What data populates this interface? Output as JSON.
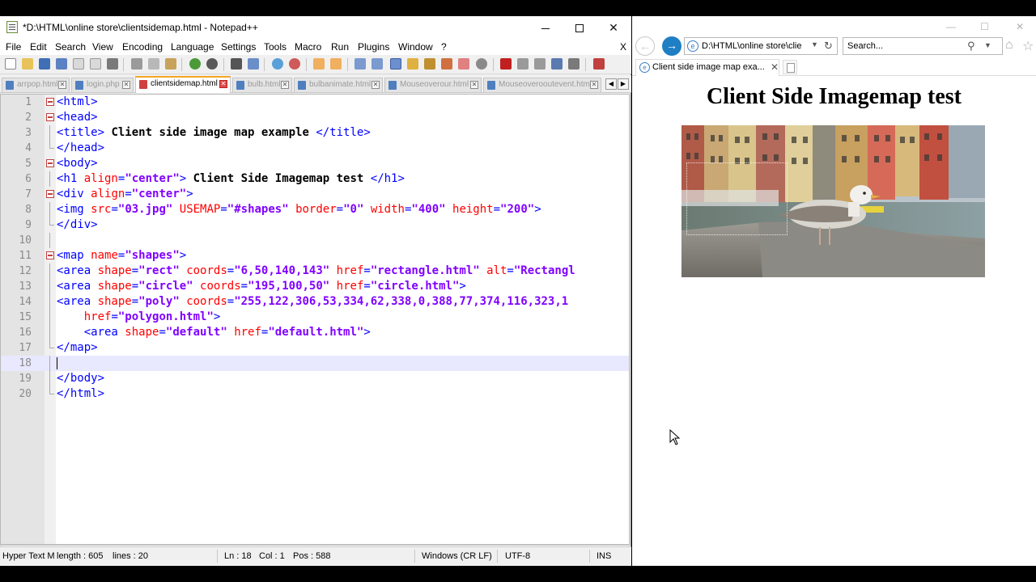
{
  "notepad": {
    "title": "*D:\\HTML\\online store\\clientsidemap.html - Notepad++",
    "menu": [
      "File",
      "Edit",
      "Search",
      "View",
      "Encoding",
      "Language",
      "Settings",
      "Tools",
      "Macro",
      "Run",
      "Plugins",
      "Window",
      "?"
    ],
    "menu_close": "X",
    "tabs": [
      {
        "label": "arrpop.html",
        "active": false
      },
      {
        "label": "login.php",
        "active": false
      },
      {
        "label": "clientsidemap.html",
        "active": true
      },
      {
        "label": "bulb.html",
        "active": false
      },
      {
        "label": "bulbanimate.html",
        "active": false
      },
      {
        "label": "Mouseoverour.html",
        "active": false
      },
      {
        "label": "Mouseoverooutevent.html",
        "active": false
      }
    ],
    "code_lines": [
      {
        "n": "1",
        "html": "<span class=\"tag\">&lt;html&gt;</span>"
      },
      {
        "n": "2",
        "html": "<span class=\"tag\">&lt;head&gt;</span>"
      },
      {
        "n": "3",
        "html": "<span class=\"tag\">&lt;title&gt;</span><span class=\"txt\"> Client side image map example </span><span class=\"tag\">&lt;/title&gt;</span>"
      },
      {
        "n": "4",
        "html": "<span class=\"tag\">&lt;/head&gt;</span>"
      },
      {
        "n": "5",
        "html": "<span class=\"tag\">&lt;body&gt;</span>"
      },
      {
        "n": "6",
        "html": "<span class=\"tag\">&lt;h1 </span><span class=\"attr\">align</span><span class=\"tag\">=</span><span class=\"val\">\"center\"</span><span class=\"tag\">&gt;</span><span class=\"txt\"> Client Side Imagemap test </span><span class=\"tag\">&lt;/h1&gt;</span>"
      },
      {
        "n": "7",
        "html": "<span class=\"tag\">&lt;div </span><span class=\"attr\">align</span><span class=\"tag\">=</span><span class=\"val\">\"center\"</span><span class=\"tag\">&gt;</span>"
      },
      {
        "n": "8",
        "html": "<span class=\"tag\">&lt;img </span><span class=\"attr\">src</span><span class=\"tag\">=</span><span class=\"val\">\"03.jpg\"</span><span class=\"tag\"> </span><span class=\"attr\">USEMAP</span><span class=\"tag\">=</span><span class=\"val\">\"#shapes\"</span><span class=\"tag\"> </span><span class=\"attr\">border</span><span class=\"tag\">=</span><span class=\"val\">\"0\"</span><span class=\"tag\"> </span><span class=\"attr\">width</span><span class=\"tag\">=</span><span class=\"val\">\"400\"</span><span class=\"tag\"> </span><span class=\"attr\">height</span><span class=\"tag\">=</span><span class=\"val\">\"200\"</span><span class=\"tag\">&gt;</span>"
      },
      {
        "n": "9",
        "html": "<span class=\"tag\">&lt;/div&gt;</span>"
      },
      {
        "n": "10",
        "html": ""
      },
      {
        "n": "11",
        "html": "<span class=\"tag\">&lt;map </span><span class=\"attr\">name</span><span class=\"tag\">=</span><span class=\"val\">\"shapes\"</span><span class=\"tag\">&gt;</span>"
      },
      {
        "n": "12",
        "html": "<span class=\"tag\">&lt;area </span><span class=\"attr\">shape</span><span class=\"tag\">=</span><span class=\"val\">\"rect\"</span><span class=\"tag\"> </span><span class=\"attr\">coords</span><span class=\"tag\">=</span><span class=\"val\">\"6,50,140,143\"</span><span class=\"tag\"> </span><span class=\"attr\">href</span><span class=\"tag\">=</span><span class=\"val\">\"rectangle.html\"</span><span class=\"tag\"> </span><span class=\"attr\">alt</span><span class=\"tag\">=</span><span class=\"val\">\"Rectangl</span>"
      },
      {
        "n": "13",
        "html": "<span class=\"tag\">&lt;area </span><span class=\"attr\">shape</span><span class=\"tag\">=</span><span class=\"val\">\"circle\"</span><span class=\"tag\"> </span><span class=\"attr\">coords</span><span class=\"tag\">=</span><span class=\"val\">\"195,100,50\"</span><span class=\"tag\"> </span><span class=\"attr\">href</span><span class=\"tag\">=</span><span class=\"val\">\"circle.html\"</span><span class=\"tag\">&gt;</span>"
      },
      {
        "n": "14",
        "html": "<span class=\"tag\">&lt;area </span><span class=\"attr\">shape</span><span class=\"tag\">=</span><span class=\"val\">\"poly\"</span><span class=\"tag\"> </span><span class=\"attr\">coords</span><span class=\"tag\">=</span><span class=\"val\">\"255,122,306,53,334,62,338,0,388,77,374,116,323,1</span>"
      },
      {
        "n": "15",
        "html": "    <span class=\"attr\">href</span><span class=\"tag\">=</span><span class=\"val\">\"polygon.html\"</span><span class=\"tag\">&gt;</span>"
      },
      {
        "n": "16",
        "html": "    <span class=\"tag\">&lt;area </span><span class=\"attr\">shape</span><span class=\"tag\">=</span><span class=\"val\">\"default\"</span><span class=\"tag\"> </span><span class=\"attr\">href</span><span class=\"tag\">=</span><span class=\"val\">\"default.html\"</span><span class=\"tag\">&gt;</span>"
      },
      {
        "n": "17",
        "html": "<span class=\"tag\">&lt;/map&gt;</span>"
      },
      {
        "n": "18",
        "html": ""
      },
      {
        "n": "19",
        "html": "<span class=\"tag\">&lt;/body&gt;</span>"
      },
      {
        "n": "20",
        "html": "<span class=\"tag\">&lt;/html&gt;</span>"
      }
    ],
    "current_line": "18",
    "status": {
      "lang": "Hyper Text M",
      "length": "length : 605",
      "lines": "lines : 20",
      "ln": "Ln : 18",
      "col": "Col : 1",
      "pos": "Pos : 588",
      "eol": "Windows (CR LF)",
      "encoding": "UTF-8",
      "mode": "INS"
    }
  },
  "browser": {
    "address": "D:\\HTML\\online store\\clie",
    "search_placeholder": "Search...",
    "tab_title": "Client side image map exa...",
    "page_heading": "Client Side Imagemap test"
  },
  "colors": {
    "tag": "#0000ff",
    "attribute": "#ff0000",
    "value": "#8000ff",
    "current_line": "#e8e8ff",
    "active_tab_accent": "#f5a623"
  }
}
